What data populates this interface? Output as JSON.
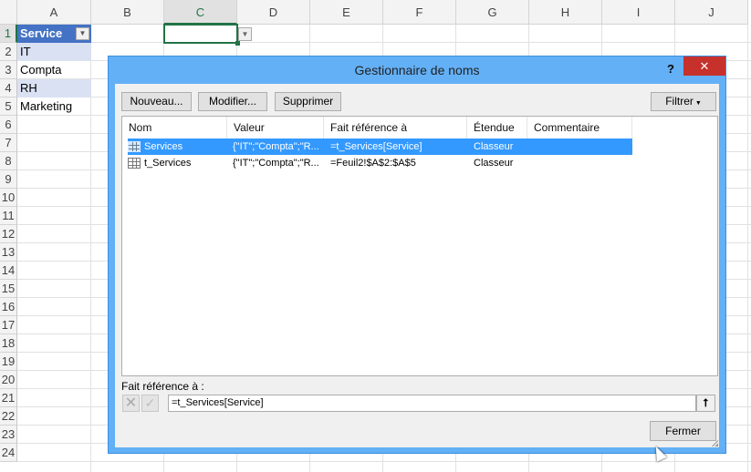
{
  "sheet": {
    "columns": [
      "A",
      "B",
      "C",
      "D",
      "E",
      "F",
      "G",
      "H",
      "I",
      "J"
    ],
    "rows": [
      "1",
      "2",
      "3",
      "4",
      "5",
      "6",
      "7",
      "8",
      "9",
      "10",
      "11",
      "12",
      "13",
      "14",
      "15",
      "16",
      "17",
      "18",
      "19",
      "20",
      "21",
      "22",
      "23",
      "24"
    ],
    "cells": {
      "A1": "Service",
      "A2": "IT",
      "A3": "Compta",
      "A4": "RH",
      "A5": "Marketing"
    },
    "table_header_color": "#4472c4",
    "table_band_color": "#d9e1f2",
    "selection_color": "#217346"
  },
  "dialog": {
    "title": "Gestionnaire de noms",
    "help": "?",
    "close": "✕",
    "buttons": {
      "new": "Nouveau...",
      "edit": "Modifier...",
      "delete": "Supprimer",
      "filter": "Filtrer",
      "close": "Fermer"
    },
    "columns": [
      "Nom",
      "Valeur",
      "Fait référence à",
      "Étendue",
      "Commentaire"
    ],
    "rows": [
      {
        "name": "Services",
        "value": "{\"IT\";\"Compta\";\"R...",
        "ref": "=t_Services[Service]",
        "scope": "Classeur",
        "comment": "",
        "selected": true
      },
      {
        "name": "t_Services",
        "value": "{\"IT\";\"Compta\";\"R...",
        "ref": "=Feuil2!$A$2:$A$5",
        "scope": "Classeur",
        "comment": "",
        "selected": false
      }
    ],
    "ref_label": "Fait référence à :",
    "ref_value": "=t_Services[Service]",
    "highlight_color": "#3399ff"
  }
}
